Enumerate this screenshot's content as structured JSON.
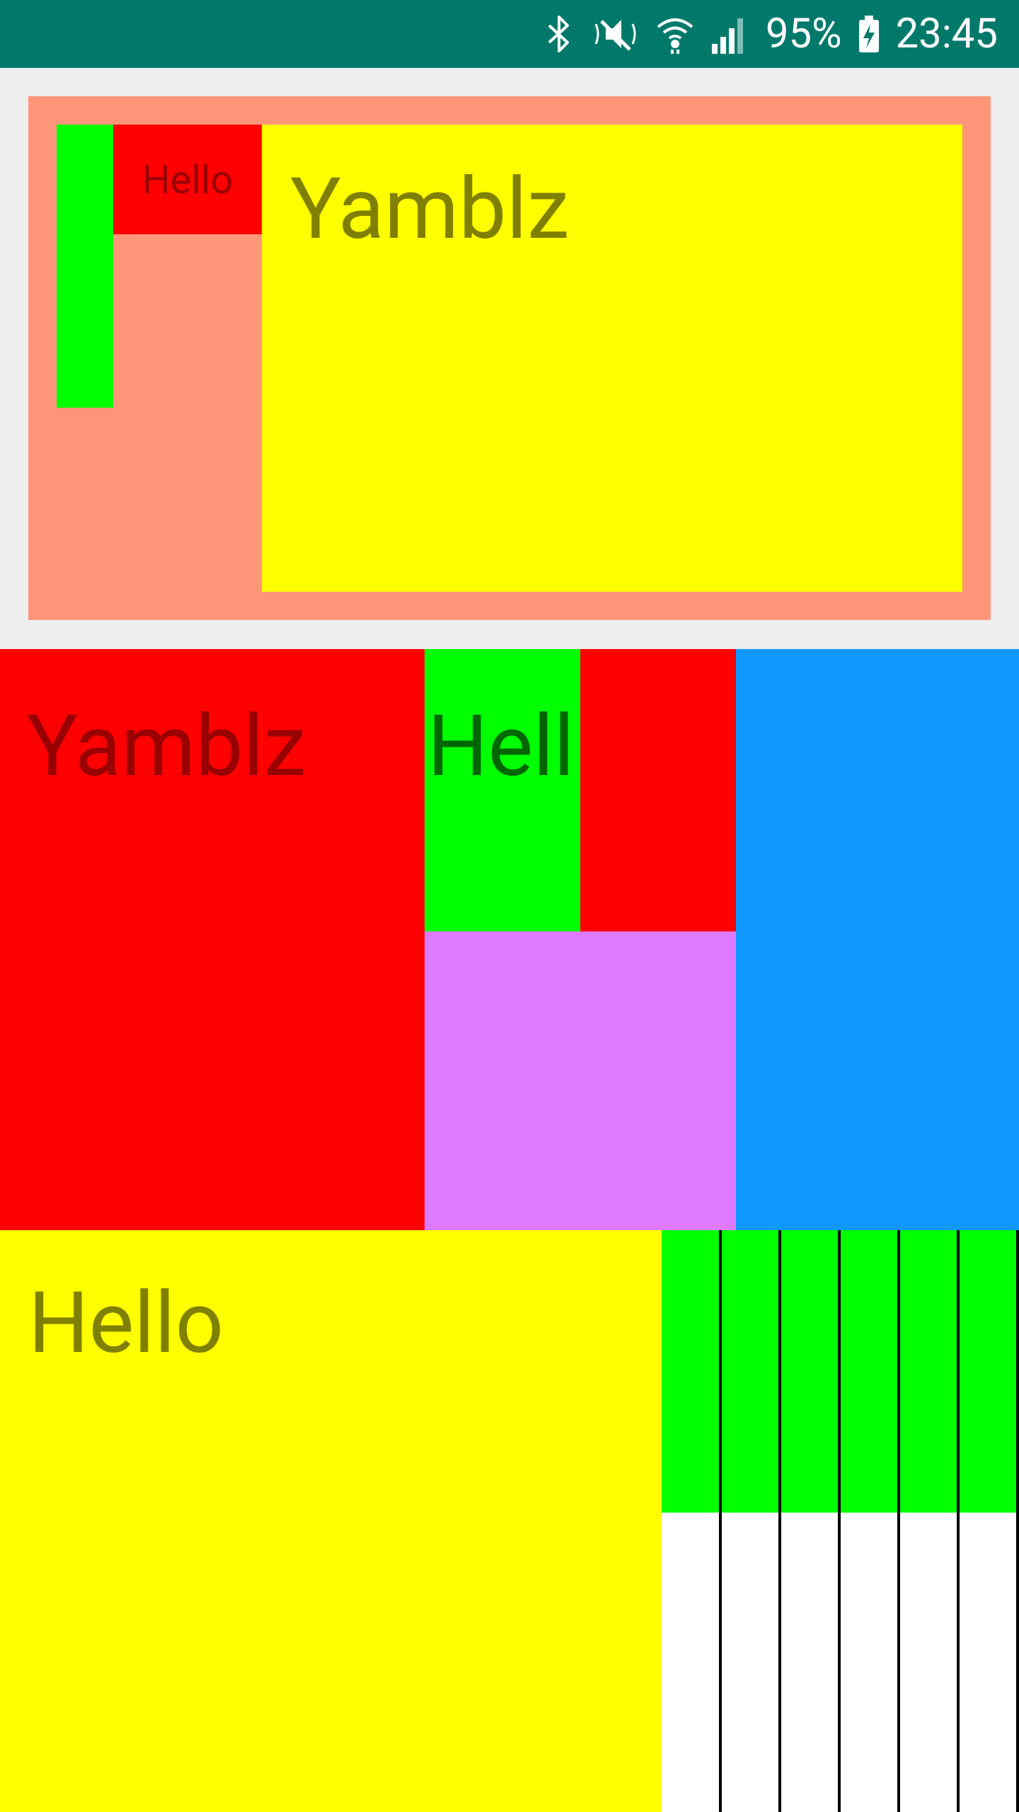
{
  "status_bar": {
    "battery": "95%",
    "time": "23:45",
    "icons": [
      "bluetooth-icon",
      "mute-icon",
      "wifi-icon",
      "signal-icon",
      "battery-charging-icon"
    ]
  },
  "colors": {
    "status_bar": "#00796b",
    "page_bg": "#eeeeee",
    "salmon": "#ff967a",
    "green": "#00ff00",
    "red": "#ff0000",
    "yellow": "#ffff00",
    "purple": "#df79ff",
    "blue": "#1299ff",
    "white": "#ffffff"
  },
  "section1": {
    "small_label": "Hello",
    "title": "Yamblz"
  },
  "section2": {
    "title": "Yamblz",
    "truncated_label": "Hell"
  },
  "section3": {
    "title": "Hello"
  }
}
